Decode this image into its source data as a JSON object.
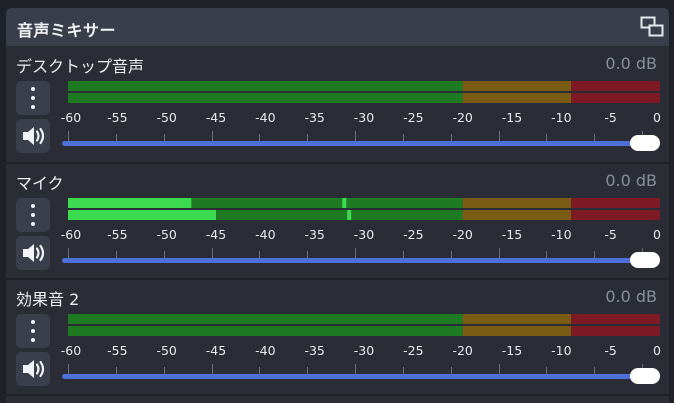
{
  "header": {
    "title": "音声ミキサー",
    "undock_icon": "undock-icon"
  },
  "colors": {
    "green": "#1f7a24",
    "green_active": "#3ddc50",
    "yellow": "#7a5c14",
    "red": "#7d1a24",
    "slider": "#4f6fd8"
  },
  "scale": {
    "ticks": [
      "-60",
      "-55",
      "-50",
      "-45",
      "-40",
      "-35",
      "-30",
      "-25",
      "-20",
      "-15",
      "-10",
      "-5",
      "0"
    ]
  },
  "channels": [
    {
      "name": "デスクトップ音声",
      "db": "0.0 dB",
      "levels": {
        "ch1": null,
        "ch2": null,
        "peak1": null,
        "peak2": null
      },
      "volume": 1.0
    },
    {
      "name": "マイク",
      "db": "0.0 dB",
      "levels": {
        "ch1": -47.5,
        "ch2": -45,
        "peak1": -32,
        "peak2": -31.5
      },
      "volume": 1.0
    },
    {
      "name": "効果音 2",
      "db": "0.0 dB",
      "levels": {
        "ch1": null,
        "ch2": null,
        "peak1": null,
        "peak2": null
      },
      "volume": 1.0
    }
  ]
}
